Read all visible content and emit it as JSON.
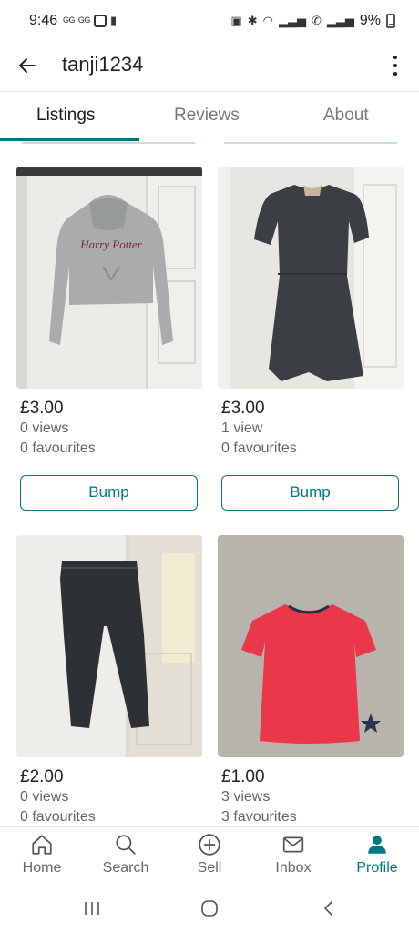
{
  "status_bar": {
    "time": "9:46",
    "battery": "9%",
    "left_icons": [
      "sim-icon",
      "sim-icon",
      "image-icon",
      "alert-icon"
    ],
    "right_icons": [
      "battery-saver-icon",
      "bluetooth-icon",
      "wifi-icon",
      "signal-icon",
      "wifi-call-icon",
      "signal-icon"
    ]
  },
  "header": {
    "back_icon": "arrow-left-icon",
    "title": "tanji1234",
    "menu_icon": "more-vertical-icon"
  },
  "tabs": [
    {
      "label": "Listings",
      "active": true
    },
    {
      "label": "Reviews",
      "active": false
    },
    {
      "label": "About",
      "active": false
    }
  ],
  "listings": [
    {
      "price": "£3.00",
      "views": "0 views",
      "favourites": "0 favourites",
      "action": "Bump",
      "image": "grey Harry Potter hoodie",
      "print": "Harry Potter"
    },
    {
      "price": "£3.00",
      "views": "1 view",
      "favourites": "0 favourites",
      "action": "Bump",
      "image": "dark grey dress"
    },
    {
      "price": "£2.00",
      "views": "0 views",
      "favourites": "0 favourites",
      "image": "black jeans"
    },
    {
      "price": "£1.00",
      "views": "3 views",
      "favourites": "3 favourites",
      "image": "pink t-shirt"
    }
  ],
  "bottom_nav": [
    {
      "label": "Home",
      "icon": "home-icon",
      "active": false
    },
    {
      "label": "Search",
      "icon": "search-icon",
      "active": false
    },
    {
      "label": "Sell",
      "icon": "plus-circle-icon",
      "active": false
    },
    {
      "label": "Inbox",
      "icon": "mail-icon",
      "active": false
    },
    {
      "label": "Profile",
      "icon": "person-icon",
      "active": true
    }
  ],
  "colors": {
    "accent": "#007782",
    "text": "#1a1a1a",
    "muted": "#666666"
  }
}
